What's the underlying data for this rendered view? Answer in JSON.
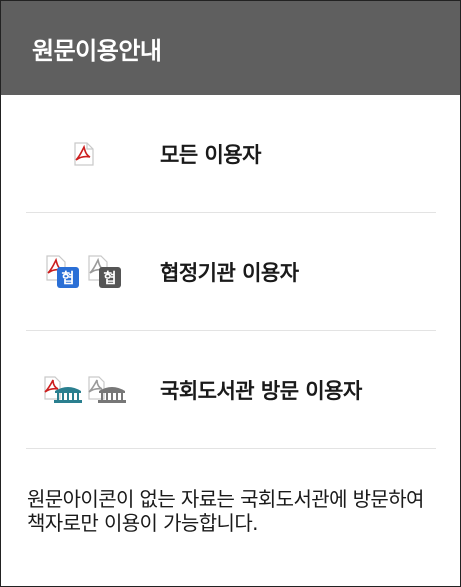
{
  "header": {
    "title": "원문이용안내"
  },
  "rows": [
    {
      "label": "모든 이용자",
      "icons": [
        "pdf-icon"
      ]
    },
    {
      "label": "협정기관 이용자",
      "icons": [
        "pdf-partner-color-icon",
        "pdf-partner-gray-icon"
      ],
      "badge_text": "협"
    },
    {
      "label": "국회도서관 방문 이용자",
      "icons": [
        "pdf-library-color-icon",
        "pdf-library-gray-icon"
      ]
    }
  ],
  "note": "원문아이콘이 없는 자료는 국회도서관에 방문하여 책자로만 이용이 가능합니다.",
  "colors": {
    "header_bg": "#5f5f5f",
    "pdf_red": "#cc1f1f",
    "badge_blue": "#2a6fd6",
    "badge_gray": "#555555",
    "library_teal": "#2a7f8f"
  }
}
